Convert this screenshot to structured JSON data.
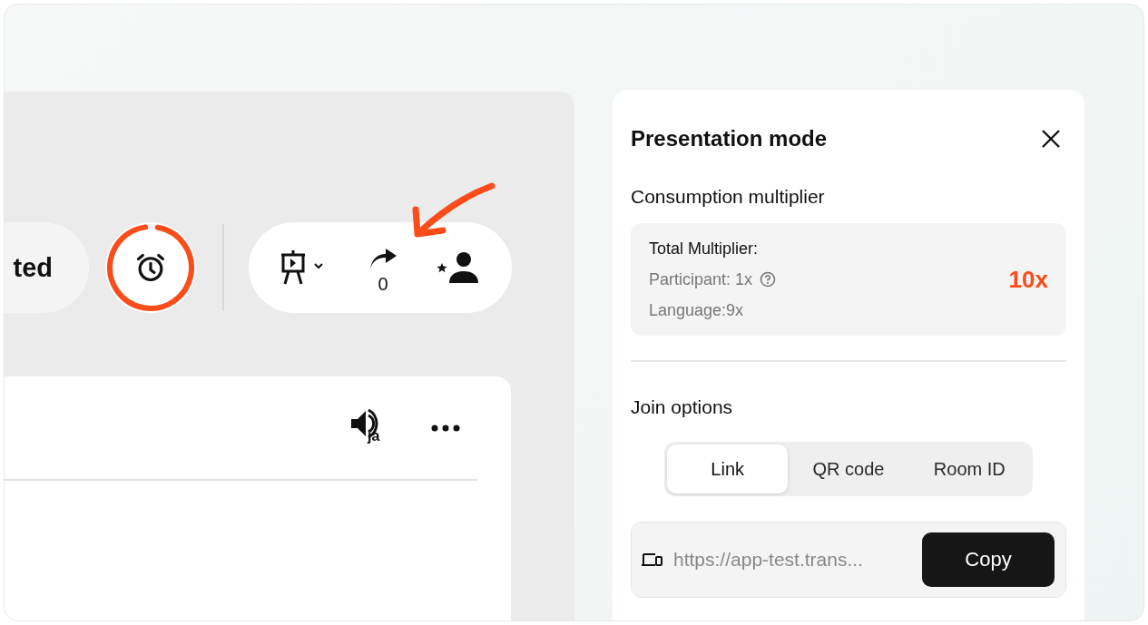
{
  "toolbar": {
    "status_pill": {
      "label": "ted"
    },
    "timer": {
      "level": 0.95
    },
    "share_count": "0"
  },
  "content_card": {
    "language_badge": "ja"
  },
  "panel": {
    "title": "Presentation mode",
    "multiplier_heading": "Consumption multiplier",
    "multiplier": {
      "title": "Total Multiplier:",
      "participant": "Participant: 1x",
      "language": "Language:9x",
      "total": "10x"
    },
    "join_heading": "Join options",
    "tabs": [
      {
        "label": "Link",
        "selected": true
      },
      {
        "label": "QR code",
        "selected": false
      },
      {
        "label": "Room ID",
        "selected": false
      }
    ],
    "link": {
      "value": "https://app-test.trans...",
      "button": "Copy"
    }
  }
}
